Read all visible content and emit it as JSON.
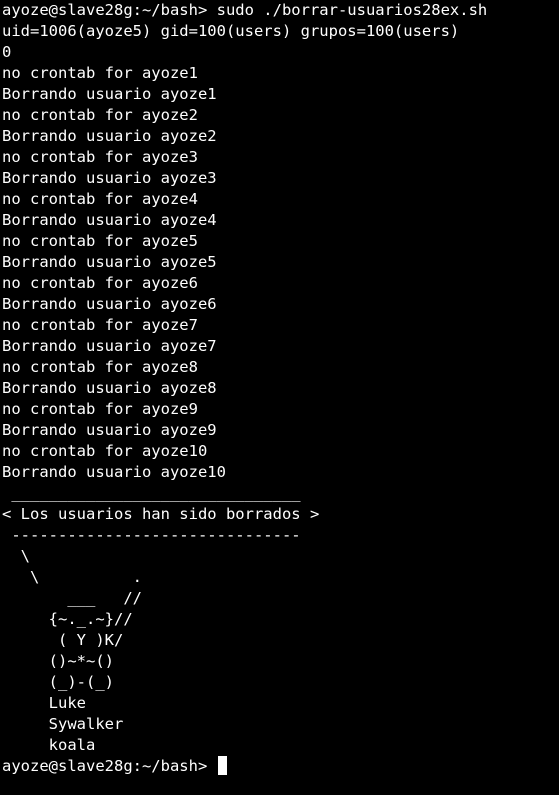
{
  "terminal": {
    "command_line": "ayoze@slave28g:~/bash> sudo ./borrar-usuarios28ex.sh",
    "id_line": "uid=1006(ayoze5) gid=100(users) grupos=100(users)",
    "exit_line": "0",
    "output": [
      "no crontab for ayoze1",
      "Borrando usuario ayoze1",
      "no crontab for ayoze2",
      "Borrando usuario ayoze2",
      "no crontab for ayoze3",
      "Borrando usuario ayoze3",
      "no crontab for ayoze4",
      "Borrando usuario ayoze4",
      "no crontab for ayoze5",
      "Borrando usuario ayoze5",
      "no crontab for ayoze6",
      "Borrando usuario ayoze6",
      "no crontab for ayoze7",
      "Borrando usuario ayoze7",
      "no crontab for ayoze8",
      "Borrando usuario ayoze8",
      "no crontab for ayoze9",
      "Borrando usuario ayoze9",
      "no crontab for ayoze10",
      "Borrando usuario ayoze10"
    ],
    "cowsay": [
      " _______________________________",
      "< Los usuarios han sido borrados >",
      " -------------------------------",
      "  \\",
      "   \\          .",
      "       ___   //",
      "     {~._.~}//",
      "      ( Y )K/",
      "     ()~*~()",
      "     (_)-(_)",
      "     Luke",
      "     Sywalker",
      "     koala"
    ],
    "prompt": "ayoze@slave28g:~/bash> "
  }
}
